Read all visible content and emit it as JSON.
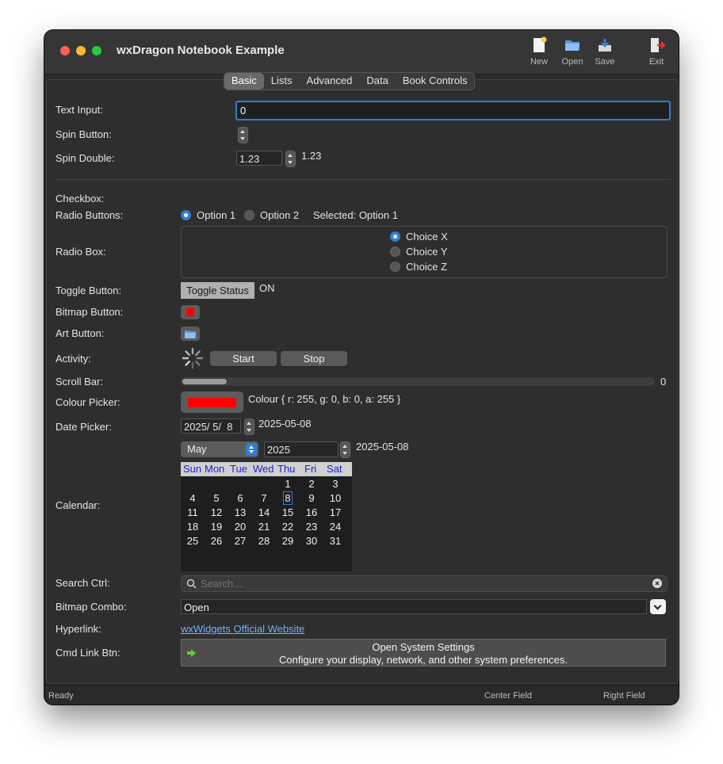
{
  "window": {
    "title": "wxDragon Notebook Example"
  },
  "toolbar": {
    "items": [
      {
        "label": "New",
        "icon": "new-document-icon"
      },
      {
        "label": "Open",
        "icon": "open-folder-icon"
      },
      {
        "label": "Save",
        "icon": "save-icon"
      },
      {
        "label": "Exit",
        "icon": "exit-icon"
      }
    ]
  },
  "tabs": [
    {
      "label": "Basic",
      "selected": true
    },
    {
      "label": "Lists",
      "selected": false
    },
    {
      "label": "Advanced",
      "selected": false
    },
    {
      "label": "Data",
      "selected": false
    },
    {
      "label": "Book Controls",
      "selected": false
    }
  ],
  "labels": {
    "text_input": "Text Input:",
    "spin_button": "Spin Button:",
    "spin_double": "Spin Double:",
    "checkbox": "Checkbox:",
    "radio_buttons": "Radio Buttons:",
    "radio_box": "Radio Box:",
    "toggle_button": "Toggle Button:",
    "bitmap_button": "Bitmap Button:",
    "art_button": "Art Button:",
    "activity": "Activity:",
    "scroll_bar": "Scroll Bar:",
    "colour_picker": "Colour Picker:",
    "date_picker": "Date Picker:",
    "calendar": "Calendar:",
    "search_ctrl": "Search Ctrl:",
    "bitmap_combo": "Bitmap Combo:",
    "hyperlink": "Hyperlink:",
    "cmd_link_btn": "Cmd Link Btn:"
  },
  "text_input": {
    "value": "0"
  },
  "spin_double": {
    "value": "1.23",
    "display": "1.23"
  },
  "radio_buttons": {
    "options": [
      {
        "label": "Option 1",
        "checked": true
      },
      {
        "label": "Option 2",
        "checked": false
      }
    ],
    "selected_text": "Selected: Option 1"
  },
  "radio_box": {
    "choices": [
      {
        "label": "Choice X",
        "checked": true
      },
      {
        "label": "Choice Y",
        "checked": false
      },
      {
        "label": "Choice Z",
        "checked": false
      }
    ]
  },
  "toggle": {
    "label": "Toggle Status",
    "state": "ON"
  },
  "bitmap_button": {
    "color": "#ff0000"
  },
  "activity": {
    "start_label": "Start",
    "stop_label": "Stop"
  },
  "scroll_bar": {
    "value": "0"
  },
  "colour_picker": {
    "color": "#ff0000",
    "text": "Colour { r: 255, g: 0, b: 0, a: 255 }"
  },
  "date_picker": {
    "value": "2025/ 5/  8",
    "display": "2025-05-08"
  },
  "calendar": {
    "month": "May",
    "year": "2025",
    "display": "2025-05-08",
    "day_names": [
      "Sun",
      "Mon",
      "Tue",
      "Wed",
      "Thu",
      "Fri",
      "Sat"
    ],
    "weeks": [
      [
        "",
        "",
        "",
        "",
        "1",
        "2",
        "3"
      ],
      [
        "4",
        "5",
        "6",
        "7",
        "8",
        "9",
        "10"
      ],
      [
        "11",
        "12",
        "13",
        "14",
        "15",
        "16",
        "17"
      ],
      [
        "18",
        "19",
        "20",
        "21",
        "22",
        "23",
        "24"
      ],
      [
        "25",
        "26",
        "27",
        "28",
        "29",
        "30",
        "31"
      ]
    ],
    "selected_day": "8",
    "header_text_color": "#1a1fd0"
  },
  "search": {
    "placeholder": "Search..."
  },
  "bitmap_combo": {
    "value": "Open"
  },
  "hyperlink": {
    "text": "wxWidgets Official Website"
  },
  "cmd_link": {
    "title": "Open System Settings",
    "note": "Configure your display, network, and other system preferences."
  },
  "status": {
    "left": "Ready",
    "center": "Center Field",
    "right": "Right Field"
  },
  "colors": {
    "accent": "#2f7fd1",
    "link": "#6cb4ff",
    "window_bg": "#2b2b2b"
  }
}
